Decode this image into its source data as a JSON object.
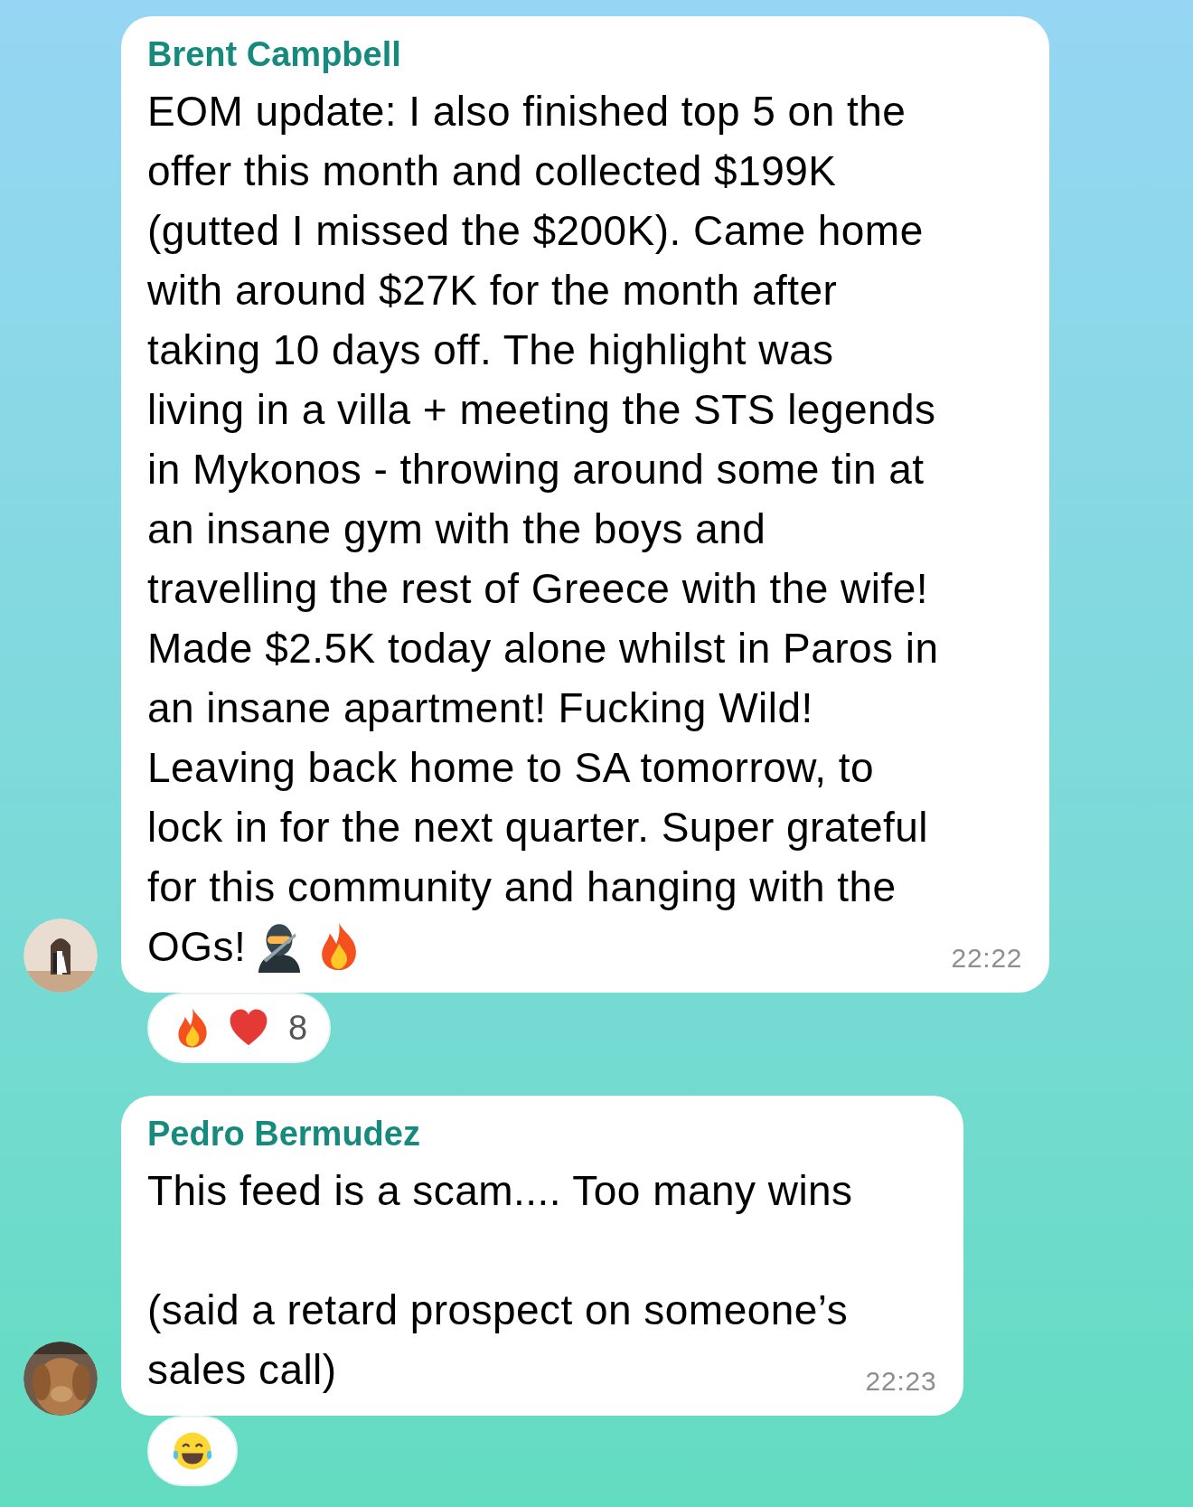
{
  "messages": [
    {
      "sender": "Brent Campbell",
      "avatar": {
        "kind": "picture"
      },
      "paragraphs": [
        {
          "lines": [
            "EOM update: I also finished top 5 on the",
            "offer this month and collected $199K",
            "(gutted I missed the $200K). Came home",
            "with around $27K for the month after",
            "taking 10 days off. The highlight was",
            "living in a villa + meeting the STS legends",
            "in Mykonos - throwing around some tin at",
            "an insane gym with the boys and",
            "travelling the rest of Greece with the wife!",
            "Made $2.5K today alone whilst in Paros in",
            "an insane apartment! Fucking Wild!",
            "Leaving back home to SA tomorrow, to",
            "lock in for the next quarter. Super grateful",
            "for this community and hanging with the"
          ]
        }
      ],
      "last_line": {
        "text": "OGs!",
        "emoji": [
          {
            "kind": "ninja"
          },
          {
            "kind": "fire"
          }
        ]
      },
      "time": "22:22",
      "reactions": {
        "emoji": [
          {
            "kind": "fire"
          },
          {
            "kind": "heart"
          }
        ],
        "count": "8"
      }
    },
    {
      "sender": "Pedro Bermudez",
      "avatar": {
        "kind": "picture"
      },
      "paragraphs": [
        {
          "lines": [
            "This feed is a scam.... Too many wins"
          ]
        },
        {
          "lines": [
            "(said a retard prospect on someone’s",
            "sales call)"
          ]
        }
      ],
      "time": "22:23",
      "reactions": {
        "emoji": [
          {
            "kind": "laugh"
          }
        ]
      }
    }
  ]
}
